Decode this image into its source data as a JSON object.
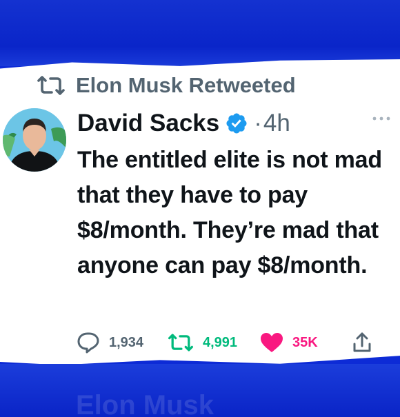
{
  "background": {
    "top_ghost_text": "",
    "bottom_ghost_text": "Elon Musk"
  },
  "social_context": {
    "text": "Elon Musk Retweeted",
    "icon": "retweet-icon"
  },
  "author": {
    "name": "David Sacks",
    "verified": true,
    "separator": "·",
    "time": "4h"
  },
  "tweet": {
    "text": "The entitled elite is not mad that they have to pay $8/month. They’re mad that anyone can pay $8/month."
  },
  "metrics": {
    "replies": "1,934",
    "retweets": "4,991",
    "likes": "35K"
  },
  "colors": {
    "band_blue": "#0d2bd6",
    "muted": "#536471",
    "text": "#0f1419",
    "verified_blue": "#1d9bf0",
    "retweet_green": "#00ba7c",
    "like_pink": "#f91880"
  },
  "icons": {
    "reply": "reply-icon",
    "retweet": "retweet-icon",
    "like": "heart-icon",
    "share": "share-icon",
    "more": "more-icon",
    "verified": "verified-badge-icon"
  }
}
